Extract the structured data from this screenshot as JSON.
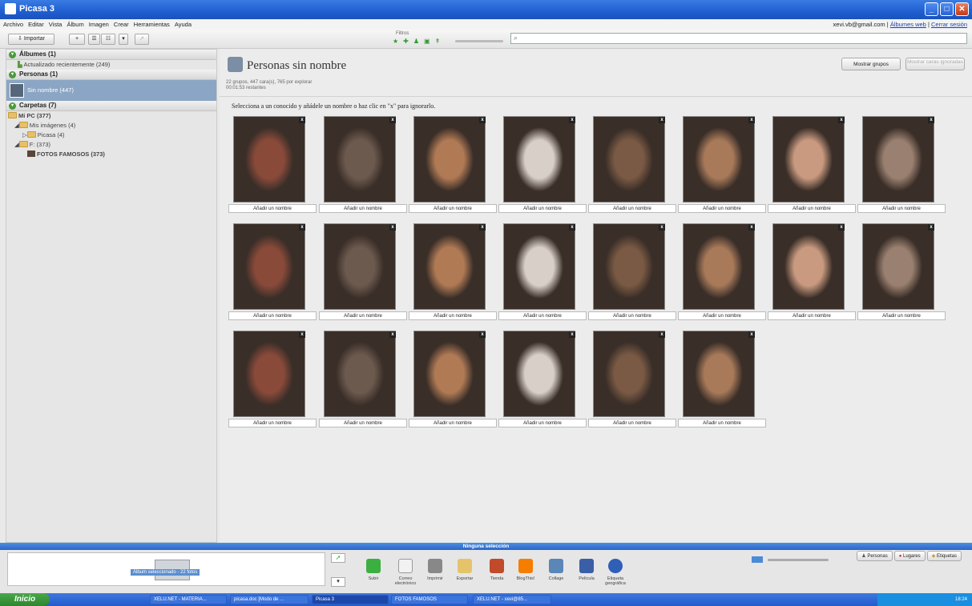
{
  "window": {
    "title": "Picasa 3"
  },
  "menu": {
    "items": [
      "Archivo",
      "Editar",
      "Vista",
      "Álbum",
      "Imagen",
      "Crear",
      "Herramientas",
      "Ayuda"
    ],
    "account": "xevi.vb@gmail.com",
    "sep": "|",
    "web_albums": "Álbumes web",
    "sign_out": "Cerrar sesión"
  },
  "toolbar": {
    "import": "Importar",
    "filters_label": "Filtros",
    "search_placeholder": ""
  },
  "sidebar": {
    "albums_header": "Álbumes (1)",
    "albums_item": "Actualizado recientemente (249)",
    "people_header": "Personas (1)",
    "people_item": "Sin nombre (447)",
    "folders_header": "Carpetas (7)",
    "folders": [
      {
        "label": "Mi PC (377)"
      },
      {
        "label": "Mis imágenes (4)"
      },
      {
        "label": "Picasa (4)"
      },
      {
        "label": "F: (373)"
      },
      {
        "label": "FOTOS FAMOSOS (373)"
      }
    ]
  },
  "main": {
    "title": "Personas sin nombre",
    "sub1": "22 grupos, 447 cara(s), 765 por explorar",
    "sub2": "00:01:53 restantes",
    "show_groups": "Mostrar grupos",
    "show_ignored": "Mostrar caras ignoradas",
    "instruction": "Selecciona a un conocido y añádele un nombre o haz clic en \"x\" para ignorarlo.",
    "add_name": "Añadir un nombre",
    "ignore_x": "x",
    "faces_count": 22
  },
  "status": {
    "text": "Ninguna selección"
  },
  "tray": {
    "tooltip": "Álbum seleccionado - 22 fotos",
    "actions": [
      "Subir",
      "Correo electrónico",
      "Imprimir",
      "Exportar",
      "Tienda",
      "BlogThis!",
      "Collage",
      "Película",
      "Etiqueta geográfica"
    ],
    "views": [
      "Personas",
      "Lugares",
      "Etiquetas"
    ]
  },
  "taskbar": {
    "start": "Inicio",
    "tasks": [
      "XELU.NET - MATERIA...",
      "picasa.doc [Modo de ...",
      "Picasa 3",
      "FOTOS FAMOSOS",
      "XELU.NET - xevi@85..."
    ],
    "clock": "18:24"
  },
  "colors": {
    "title_bar": "#2563d4",
    "selection": "#8ba6c4",
    "status_bar": "#3a7ad6"
  }
}
